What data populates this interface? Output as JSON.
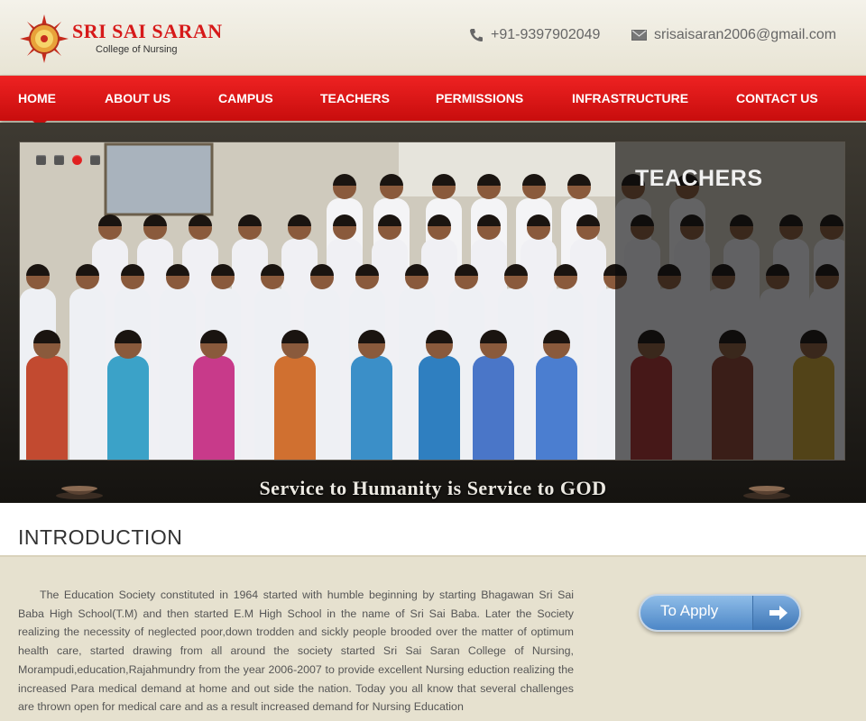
{
  "header": {
    "logo_title": "SRI SAI SARAN",
    "logo_subtitle": "College of Nursing",
    "phone": "+91-9397902049",
    "email": "srisaisaran2006@gmail.com"
  },
  "nav": {
    "items": [
      "HOME",
      "ABOUT US",
      "CAMPUS",
      "TEACHERS",
      "PERMISSIONS",
      "INFRASTRUCTURE",
      "CONTACT US"
    ],
    "active": "HOME"
  },
  "banner": {
    "slide_label": "TEACHERS",
    "tagline": "Service to Humanity is Service to GOD",
    "slider_dot_count": 4,
    "active_dot": 3
  },
  "intro": {
    "title": "INTRODUCTION",
    "text": "The Education Society constituted in 1964 started with humble beginning by starting Bhagawan Sri Sai Baba High School(T.M) and then started E.M High School in the name of Sri Sai Baba. Later the Society realizing the necessity of neglected poor,down trodden and sickly people brooded over the matter of optimum health care, started drawing from all around the society started Sri Sai Saran College of Nursing, Morampudi,education,Rajahmundry from the year 2006-2007 to provide excellent Nursing eduction realizing the increased Para medical demand at home and out side the nation. Today you all know that several challenges are thrown open for medical care and as a result increased demand for Nursing Education"
  },
  "apply_button": {
    "label": "To Apply"
  },
  "colors": {
    "nav_red": "#d61a1a",
    "apply_blue": "#4d87c7",
    "page_bg": "#e6e1cf"
  }
}
